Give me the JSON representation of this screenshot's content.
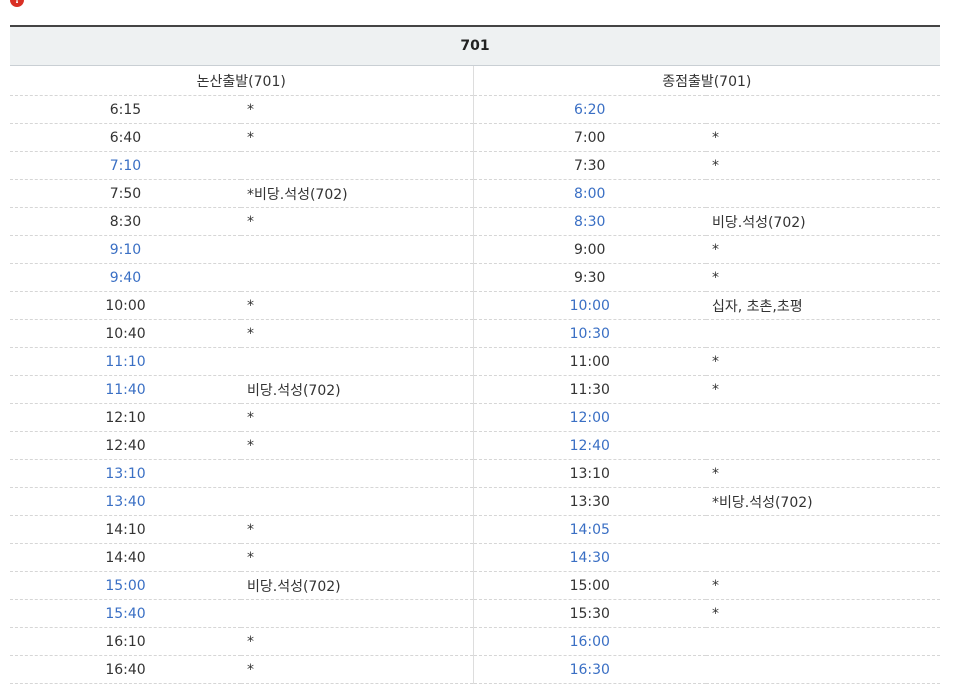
{
  "notice": {
    "icon": "alert-icon",
    "text": ""
  },
  "table": {
    "route_title": "701",
    "left_direction": "논산출발(701)",
    "right_direction": "종점출발(701)",
    "time_color_default": "#333333",
    "time_color_highlight": "#3a6fc4",
    "left": [
      {
        "time": "6:15",
        "note": "*",
        "highlight": false
      },
      {
        "time": "6:40",
        "note": "*",
        "highlight": false
      },
      {
        "time": "7:10",
        "note": "",
        "highlight": true
      },
      {
        "time": "7:50",
        "note": "*비당.석성(702)",
        "highlight": false
      },
      {
        "time": "8:30",
        "note": "*",
        "highlight": false
      },
      {
        "time": "9:10",
        "note": "",
        "highlight": true
      },
      {
        "time": "9:40",
        "note": "",
        "highlight": true
      },
      {
        "time": "10:00",
        "note": "*",
        "highlight": false
      },
      {
        "time": "10:40",
        "note": "*",
        "highlight": false
      },
      {
        "time": "11:10",
        "note": "",
        "highlight": true
      },
      {
        "time": "11:40",
        "note": "비당.석성(702)",
        "highlight": true
      },
      {
        "time": "12:10",
        "note": "*",
        "highlight": false
      },
      {
        "time": "12:40",
        "note": "*",
        "highlight": false
      },
      {
        "time": "13:10",
        "note": "",
        "highlight": true
      },
      {
        "time": "13:40",
        "note": "",
        "highlight": true
      },
      {
        "time": "14:10",
        "note": "*",
        "highlight": false
      },
      {
        "time": "14:40",
        "note": "*",
        "highlight": false
      },
      {
        "time": "15:00",
        "note": "비당.석성(702)",
        "highlight": true
      },
      {
        "time": "15:40",
        "note": "",
        "highlight": true
      },
      {
        "time": "16:10",
        "note": "*",
        "highlight": false
      },
      {
        "time": "16:40",
        "note": "*",
        "highlight": false
      }
    ],
    "right": [
      {
        "time": "6:20",
        "note": "",
        "highlight": true
      },
      {
        "time": "7:00",
        "note": "*",
        "highlight": false
      },
      {
        "time": "7:30",
        "note": "*",
        "highlight": false
      },
      {
        "time": "8:00",
        "note": "",
        "highlight": true
      },
      {
        "time": "8:30",
        "note": "비당.석성(702)",
        "highlight": true
      },
      {
        "time": "9:00",
        "note": "*",
        "highlight": false
      },
      {
        "time": "9:30",
        "note": "*",
        "highlight": false
      },
      {
        "time": "10:00",
        "note": "십자, 초촌,초평",
        "highlight": true
      },
      {
        "time": "10:30",
        "note": "",
        "highlight": true
      },
      {
        "time": "11:00",
        "note": "*",
        "highlight": false
      },
      {
        "time": "11:30",
        "note": "*",
        "highlight": false
      },
      {
        "time": "12:00",
        "note": "",
        "highlight": true
      },
      {
        "time": "12:40",
        "note": "",
        "highlight": true
      },
      {
        "time": "13:10",
        "note": "*",
        "highlight": false
      },
      {
        "time": "13:30",
        "note": "*비당.석성(702)",
        "highlight": false
      },
      {
        "time": "14:05",
        "note": "",
        "highlight": true
      },
      {
        "time": "14:30",
        "note": "",
        "highlight": true
      },
      {
        "time": "15:00",
        "note": "*",
        "highlight": false
      },
      {
        "time": "15:30",
        "note": "*",
        "highlight": false
      },
      {
        "time": "16:00",
        "note": "",
        "highlight": true
      },
      {
        "time": "16:30",
        "note": "",
        "highlight": true
      }
    ]
  }
}
